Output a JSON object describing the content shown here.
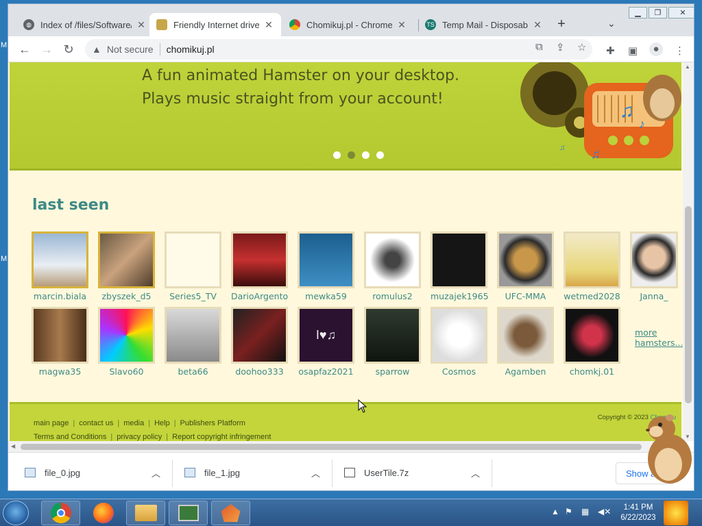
{
  "browser": {
    "tabs": [
      {
        "title": "Index of /files/Software/",
        "icon": "globe-icon",
        "active": false
      },
      {
        "title": "Friendly Internet drive -",
        "icon": "hamster-icon",
        "active": true
      },
      {
        "title": "Chomikuj.pl - Chrome W",
        "icon": "chrome-webstore-icon",
        "active": false
      },
      {
        "title": "Temp Mail - Disposable",
        "icon": "tempmail-icon",
        "active": false
      }
    ],
    "url": {
      "security_label": "Not secure",
      "host": "chomikuj.pl"
    }
  },
  "page": {
    "hero": {
      "line1": "A fun animated Hamster on your desktop.",
      "line2": "Plays music straight from your account!",
      "slides": 4,
      "active_slide": 2
    },
    "section_title": "last seen",
    "users_row1": [
      "marcin.biala",
      "zbyszek_d5",
      "Series5_TV",
      "DarioArgento",
      "mewka59",
      "romulus2",
      "muzajek1965",
      "UFC-MMA",
      "wetmed2028",
      "Janna_"
    ],
    "users_row2": [
      "magwa35",
      "Slavo60",
      "beta66",
      "doohoo333",
      "osapfaz2021",
      "sparrow",
      "Cosmos",
      "Agamben",
      "chomkj.01"
    ],
    "more": {
      "line1": "more",
      "line2": "hamsters..."
    },
    "footer": {
      "row1": [
        "main page",
        "contact us",
        "media",
        "Help",
        "Publishers Platform"
      ],
      "row2": [
        "Terms and Conditions",
        "privacy policy",
        "Report copyright infringement"
      ],
      "copyright": "Copyright © 2023",
      "copyright_link": "Chomiku"
    }
  },
  "downloads": {
    "items": [
      "file_0.jpg",
      "file_1.jpg",
      "UserTile.7z"
    ],
    "show_all": "Show all"
  },
  "taskbar": {
    "time": "1:41 PM",
    "date": "6/22/2023"
  },
  "colors": {
    "accent_teal": "#3d8a86",
    "hero_green": "#bfd33a",
    "page_bg": "#fff8dc"
  }
}
